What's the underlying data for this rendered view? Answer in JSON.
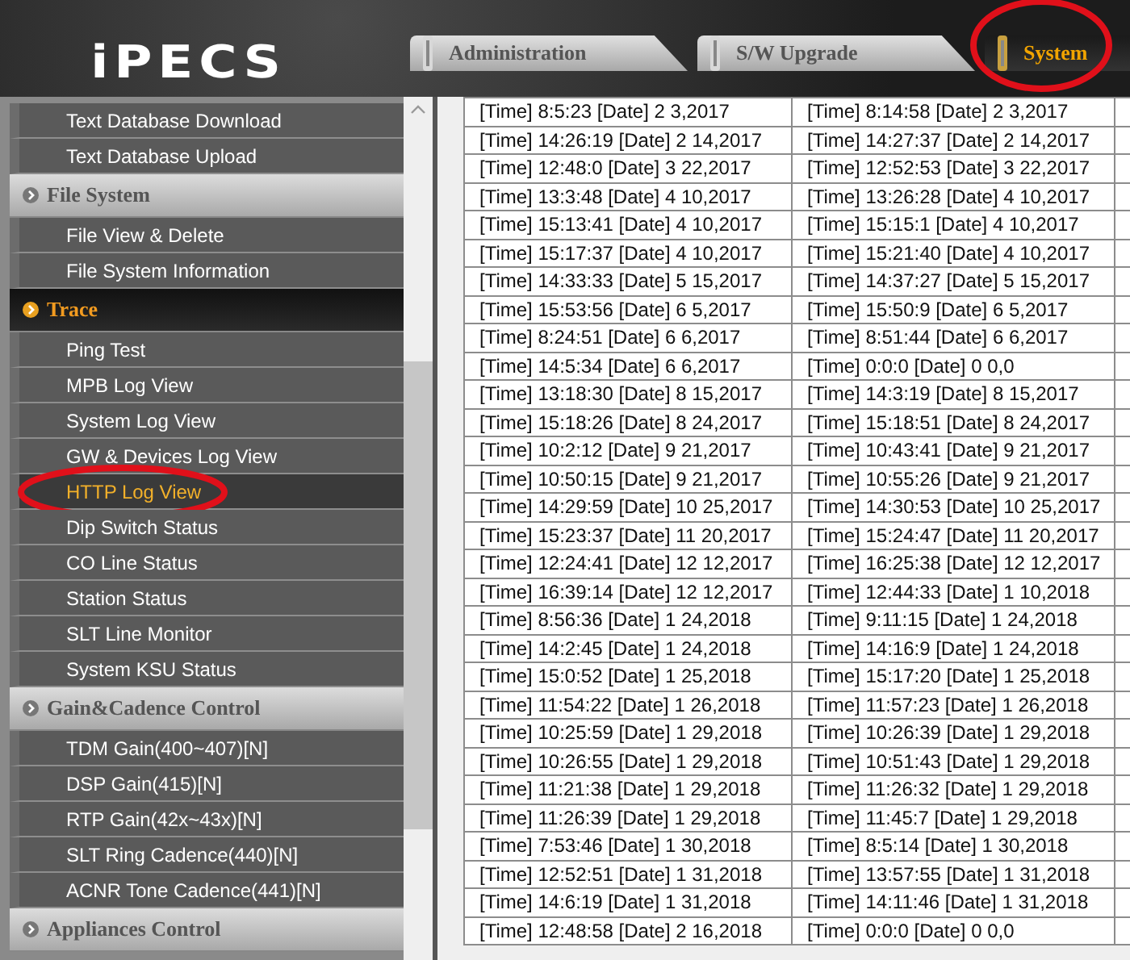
{
  "logo": "iPECS",
  "tabs": [
    {
      "label": "Administration",
      "selected": false,
      "circled": false
    },
    {
      "label": "S/W Upgrade",
      "selected": false,
      "circled": false
    },
    {
      "label": "System",
      "selected": true,
      "circled": true
    }
  ],
  "sidebar": {
    "items": [
      {
        "kind": "item",
        "label": "Text Database Download",
        "selected": false,
        "circled": false
      },
      {
        "kind": "item",
        "label": "Text Database Upload",
        "selected": false,
        "circled": false
      },
      {
        "kind": "section",
        "label": "File System",
        "selected": false
      },
      {
        "kind": "item",
        "label": "File View & Delete",
        "selected": false,
        "circled": false
      },
      {
        "kind": "item",
        "label": "File System Information",
        "selected": false,
        "circled": false
      },
      {
        "kind": "section",
        "label": "Trace",
        "selected": true
      },
      {
        "kind": "item",
        "label": "Ping Test",
        "selected": false,
        "circled": false
      },
      {
        "kind": "item",
        "label": "MPB Log View",
        "selected": false,
        "circled": false
      },
      {
        "kind": "item",
        "label": "System Log View",
        "selected": false,
        "circled": false
      },
      {
        "kind": "item",
        "label": "GW & Devices Log View",
        "selected": false,
        "circled": false
      },
      {
        "kind": "item",
        "label": "HTTP Log View",
        "selected": true,
        "circled": true
      },
      {
        "kind": "item",
        "label": "Dip Switch Status",
        "selected": false,
        "circled": false
      },
      {
        "kind": "item",
        "label": "CO Line Status",
        "selected": false,
        "circled": false
      },
      {
        "kind": "item",
        "label": "Station Status",
        "selected": false,
        "circled": false
      },
      {
        "kind": "item",
        "label": "SLT Line Monitor",
        "selected": false,
        "circled": false
      },
      {
        "kind": "item",
        "label": "System KSU Status",
        "selected": false,
        "circled": false
      },
      {
        "kind": "section",
        "label": "Gain&Cadence Control",
        "selected": false
      },
      {
        "kind": "item",
        "label": "TDM Gain(400~407)[N]",
        "selected": false,
        "circled": false
      },
      {
        "kind": "item",
        "label": "DSP Gain(415)[N]",
        "selected": false,
        "circled": false
      },
      {
        "kind": "item",
        "label": "RTP Gain(42x~43x)[N]",
        "selected": false,
        "circled": false
      },
      {
        "kind": "item",
        "label": "SLT Ring Cadence(440)[N]",
        "selected": false,
        "circled": false
      },
      {
        "kind": "item",
        "label": "ACNR Tone Cadence(441)[N]",
        "selected": false,
        "circled": false
      },
      {
        "kind": "section",
        "label": "Appliances Control",
        "selected": false
      }
    ]
  },
  "log_table": {
    "rows": [
      [
        "[Time] 8:5:23 [Date] 2 3,2017",
        "[Time] 8:14:58 [Date] 2 3,2017"
      ],
      [
        "[Time] 14:26:19 [Date] 2 14,2017",
        "[Time] 14:27:37 [Date] 2 14,2017"
      ],
      [
        "[Time] 12:48:0 [Date] 3 22,2017",
        "[Time] 12:52:53 [Date] 3 22,2017"
      ],
      [
        "[Time] 13:3:48 [Date] 4 10,2017",
        "[Time] 13:26:28 [Date] 4 10,2017"
      ],
      [
        "[Time] 15:13:41 [Date] 4 10,2017",
        "[Time] 15:15:1 [Date] 4 10,2017"
      ],
      [
        "[Time] 15:17:37 [Date] 4 10,2017",
        "[Time] 15:21:40 [Date] 4 10,2017"
      ],
      [
        "[Time] 14:33:33 [Date] 5 15,2017",
        "[Time] 14:37:27 [Date] 5 15,2017"
      ],
      [
        "[Time] 15:53:56 [Date] 6 5,2017",
        "[Time] 15:50:9 [Date] 6 5,2017"
      ],
      [
        "[Time] 8:24:51 [Date] 6 6,2017",
        "[Time] 8:51:44 [Date] 6 6,2017"
      ],
      [
        "[Time] 14:5:34 [Date] 6 6,2017",
        "[Time] 0:0:0 [Date] 0 0,0"
      ],
      [
        "[Time] 13:18:30 [Date] 8 15,2017",
        "[Time] 14:3:19 [Date] 8 15,2017"
      ],
      [
        "[Time] 15:18:26 [Date] 8 24,2017",
        "[Time] 15:18:51 [Date] 8 24,2017"
      ],
      [
        "[Time] 10:2:12 [Date] 9 21,2017",
        "[Time] 10:43:41 [Date] 9 21,2017"
      ],
      [
        "[Time] 10:50:15 [Date] 9 21,2017",
        "[Time] 10:55:26 [Date] 9 21,2017"
      ],
      [
        "[Time] 14:29:59 [Date] 10 25,2017",
        "[Time] 14:30:53 [Date] 10 25,2017"
      ],
      [
        "[Time] 15:23:37 [Date] 11 20,2017",
        "[Time] 15:24:47 [Date] 11 20,2017"
      ],
      [
        "[Time] 12:24:41 [Date] 12 12,2017",
        "[Time] 16:25:38 [Date] 12 12,2017"
      ],
      [
        "[Time] 16:39:14 [Date] 12 12,2017",
        "[Time] 12:44:33 [Date] 1 10,2018"
      ],
      [
        "[Time] 8:56:36 [Date] 1 24,2018",
        "[Time] 9:11:15 [Date] 1 24,2018"
      ],
      [
        "[Time] 14:2:45 [Date] 1 24,2018",
        "[Time] 14:16:9 [Date] 1 24,2018"
      ],
      [
        "[Time] 15:0:52 [Date] 1 25,2018",
        "[Time] 15:17:20 [Date] 1 25,2018"
      ],
      [
        "[Time] 11:54:22 [Date] 1 26,2018",
        "[Time] 11:57:23 [Date] 1 26,2018"
      ],
      [
        "[Time] 10:25:59 [Date] 1 29,2018",
        "[Time] 10:26:39 [Date] 1 29,2018"
      ],
      [
        "[Time] 10:26:55 [Date] 1 29,2018",
        "[Time] 10:51:43 [Date] 1 29,2018"
      ],
      [
        "[Time] 11:21:38 [Date] 1 29,2018",
        "[Time] 11:26:32 [Date] 1 29,2018"
      ],
      [
        "[Time] 11:26:39 [Date] 1 29,2018",
        "[Time] 11:45:7 [Date] 1 29,2018"
      ],
      [
        "[Time] 7:53:46 [Date] 1 30,2018",
        "[Time] 8:5:14 [Date] 1 30,2018"
      ],
      [
        "[Time] 12:52:51 [Date] 1 31,2018",
        "[Time] 13:57:55 [Date] 1 31,2018"
      ],
      [
        "[Time] 14:6:19 [Date] 1 31,2018",
        "[Time] 14:11:46 [Date] 1 31,2018"
      ],
      [
        "[Time] 12:48:58 [Date] 2 16,2018",
        "[Time] 0:0:0 [Date] 0 0,0"
      ]
    ]
  }
}
